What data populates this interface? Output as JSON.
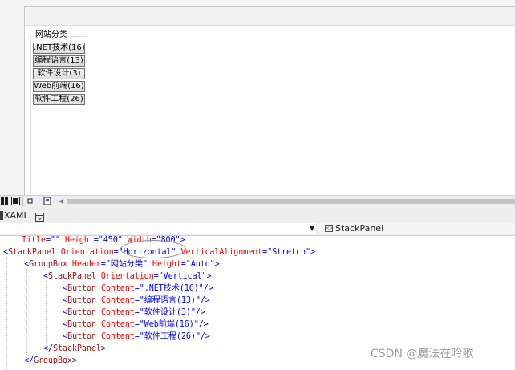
{
  "designer": {
    "groupbox_header": "网站分类",
    "buttons": [
      ".NET技术(16)",
      "编程语言(13)",
      "软件设计(3)",
      "Web前端(16)",
      "软件工程(26)"
    ]
  },
  "toolbar": {
    "xaml_tab": "XAML"
  },
  "nav_bar": {
    "right_dropdown": "StackPanel"
  },
  "code_lines": [
    [
      {
        "t": "Title",
        "c": "at"
      },
      {
        "t": "=\"\" ",
        "c": "va"
      },
      {
        "t": "Height",
        "c": "at"
      },
      {
        "t": "=\"450\" ",
        "c": "va"
      },
      {
        "t": "Width",
        "c": "at"
      },
      {
        "t": "=\"800\"",
        "c": "va"
      },
      {
        "t": ">",
        "c": "br"
      }
    ],
    [
      {
        "t": "<",
        "c": "br"
      },
      {
        "t": "StackPanel",
        "c": "el"
      },
      {
        "t": " Orientation",
        "c": "at"
      },
      {
        "t": "=\"Horizontal\"",
        "c": "va"
      },
      {
        "t": " VerticalAlignment",
        "c": "at"
      },
      {
        "t": "=\"Stretch\"",
        "c": "va"
      },
      {
        "t": ">",
        "c": "br"
      }
    ],
    [
      {
        "t": "<",
        "c": "br"
      },
      {
        "t": "GroupBox",
        "c": "el"
      },
      {
        "t": " Header",
        "c": "at"
      },
      {
        "t": "=\"网站分类\"",
        "c": "va"
      },
      {
        "t": " Height",
        "c": "at"
      },
      {
        "t": "=\"Auto\"",
        "c": "va"
      },
      {
        "t": ">",
        "c": "br"
      }
    ],
    [
      {
        "t": "<",
        "c": "br"
      },
      {
        "t": "StackPanel",
        "c": "el"
      },
      {
        "t": " Orientation",
        "c": "at"
      },
      {
        "t": "=\"Vertical\"",
        "c": "va"
      },
      {
        "t": ">",
        "c": "br"
      }
    ],
    [
      {
        "t": "<",
        "c": "br"
      },
      {
        "t": "Button",
        "c": "el"
      },
      {
        "t": " Content",
        "c": "at"
      },
      {
        "t": "=\".NET技术(16)\"",
        "c": "va"
      },
      {
        "t": "/>",
        "c": "br"
      }
    ],
    [
      {
        "t": "<",
        "c": "br"
      },
      {
        "t": "Button",
        "c": "el"
      },
      {
        "t": " Content",
        "c": "at"
      },
      {
        "t": "=\"编程语言(13)\"",
        "c": "va"
      },
      {
        "t": "/>",
        "c": "br"
      }
    ],
    [
      {
        "t": "<",
        "c": "br"
      },
      {
        "t": "Button",
        "c": "el"
      },
      {
        "t": " Content",
        "c": "at"
      },
      {
        "t": "=\"软件设计(3)\"",
        "c": "va"
      },
      {
        "t": "/>",
        "c": "br"
      }
    ],
    [
      {
        "t": "<",
        "c": "br"
      },
      {
        "t": "Button",
        "c": "el"
      },
      {
        "t": " Content",
        "c": "at"
      },
      {
        "t": "=\"Web前端(16)\"",
        "c": "va"
      },
      {
        "t": "/>",
        "c": "br"
      }
    ],
    [
      {
        "t": "<",
        "c": "br"
      },
      {
        "t": "Button",
        "c": "el"
      },
      {
        "t": " Content",
        "c": "at"
      },
      {
        "t": "=\"软件工程(26)\"",
        "c": "va"
      },
      {
        "t": "/>",
        "c": "br"
      }
    ],
    [
      {
        "t": "</",
        "c": "br"
      },
      {
        "t": "StackPanel",
        "c": "el"
      },
      {
        "t": ">",
        "c": "br"
      }
    ],
    [
      {
        "t": "</",
        "c": "br"
      },
      {
        "t": "GroupBox",
        "c": "el"
      },
      {
        "t": ">",
        "c": "br"
      }
    ]
  ],
  "watermark": "CSDN @魔法在吟歌",
  "colors": {
    "br": "#0000ff",
    "el": "#a31515",
    "at": "#ff0000",
    "va": "#0000ff"
  }
}
